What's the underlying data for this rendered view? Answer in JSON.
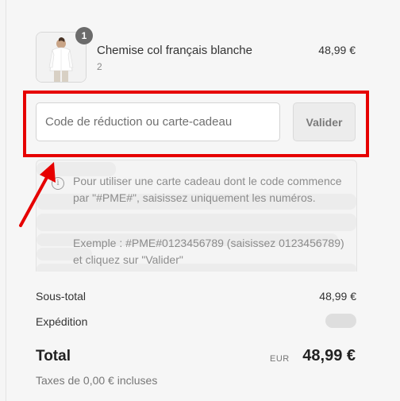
{
  "product": {
    "name": "Chemise col français blanche",
    "variant": "2",
    "price": "48,99 €",
    "quantity": "1",
    "thumbnail_icon": "white-shirt-model-photo"
  },
  "discount": {
    "placeholder": "Code de réduction ou carte-cadeau",
    "value": "",
    "button_label": "Valider"
  },
  "info": {
    "icon": "info-icon",
    "text": "Pour utiliser une carte cadeau dont le code commence par \"#PME#\", saisissez uniquement les numéros.",
    "example": "Exemple : #PME#0123456789 (saisissez 0123456789) et cliquez sur \"Valider\""
  },
  "summary": {
    "subtotal_label": "Sous-total",
    "subtotal_value": "48,99 €",
    "shipping_label": "Expédition",
    "total_label": "Total",
    "total_currency": "EUR",
    "total_value": "48,99 €",
    "tax_note": "Taxes de 0,00 € incluses"
  },
  "colors": {
    "highlight": "#e60000",
    "arrow": "#e60000"
  }
}
